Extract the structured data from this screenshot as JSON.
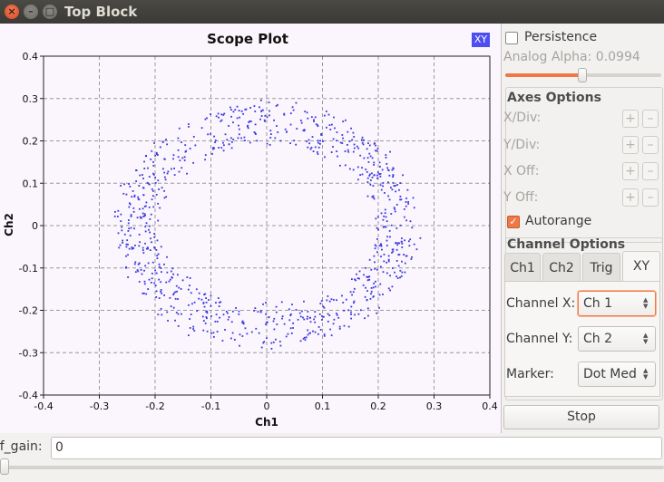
{
  "window": {
    "title": "Top Block",
    "close_glyph": "×",
    "min_glyph": "–",
    "max_glyph": "□"
  },
  "plot": {
    "title": "Scope Plot",
    "xlabel": "Ch1",
    "ylabel": "Ch2",
    "mode_badge": "XY",
    "marker_color": "#3838e0",
    "x_ticks": [
      "-0.4",
      "-0.3",
      "-0.2",
      "-0.1",
      "0",
      "0.1",
      "0.2",
      "0.3",
      "0.4"
    ],
    "y_ticks": [
      "0.4",
      "0.3",
      "0.2",
      "0.1",
      "0",
      "-0.1",
      "-0.2",
      "-0.3",
      "-0.4"
    ]
  },
  "chart_data": {
    "type": "scatter",
    "title": "Scope Plot",
    "xlabel": "Ch1",
    "ylabel": "Ch2",
    "xlim": [
      -0.4,
      0.4
    ],
    "ylim": [
      -0.4,
      0.4
    ],
    "grid": true,
    "series": [
      {
        "shape": "noisy ring",
        "center": [
          0.0,
          0.0
        ],
        "inner_radius_x": 0.2,
        "outer_radius_x": 0.27,
        "inner_radius_y": 0.19,
        "outer_radius_y": 0.29,
        "approx_point_count": 900
      }
    ]
  },
  "panel": {
    "persistence_label": "Persistence",
    "persistence_checked": false,
    "analog_alpha_label": "Analog Alpha: 0.0994",
    "alpha_value": 0.0994,
    "axes_options_title": "Axes Options",
    "axes_rows": [
      {
        "label": "X/Div:",
        "plus": "+",
        "minus": "–"
      },
      {
        "label": "Y/Div:",
        "plus": "+",
        "minus": "–"
      },
      {
        "label": "X Off:",
        "plus": "+",
        "minus": "–"
      },
      {
        "label": "Y Off:",
        "plus": "+",
        "minus": "–"
      }
    ],
    "autorange_label": "Autorange",
    "autorange_checked": true,
    "channel_options_title": "Channel Options",
    "tabs": [
      "Ch1",
      "Ch2",
      "Trig",
      "XY"
    ],
    "active_tab": "XY",
    "channel_x_label": "Channel X:",
    "channel_x_value": "Ch 1",
    "channel_y_label": "Channel Y:",
    "channel_y_value": "Ch 2",
    "marker_label": "Marker:",
    "marker_value": "Dot Med",
    "stop_label": "Stop"
  },
  "bottom": {
    "rf_gain_label": "rf_gain:",
    "rf_gain_value": "0",
    "rf_gain_slider": 0
  },
  "colors": {
    "accent": "#f07746",
    "plot_bg": "#fbf5fd",
    "titlebar": "#3c3b37"
  }
}
